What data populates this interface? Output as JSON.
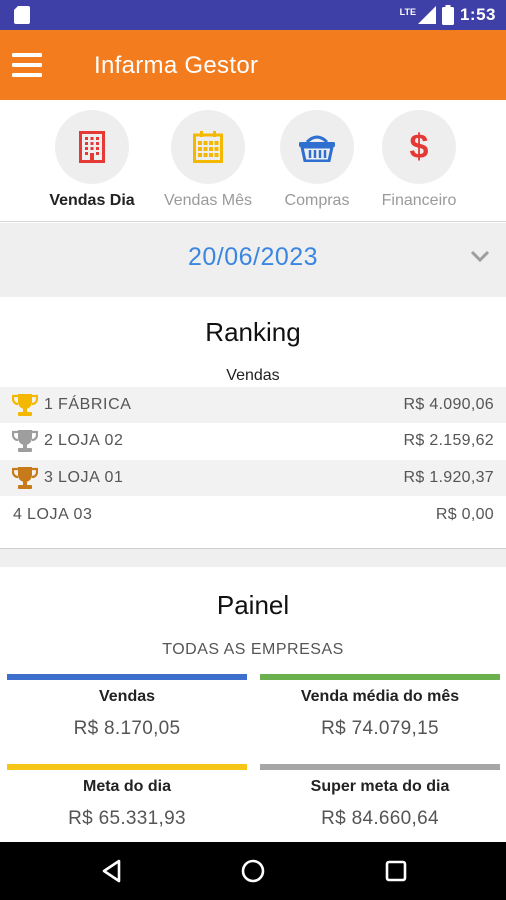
{
  "status_bar": {
    "network_label": "LTE",
    "battery_level": "1",
    "time": "1:53"
  },
  "app_bar": {
    "title": "Infarma Gestor",
    "menu_icon": "hamburger-menu-icon"
  },
  "tabs": [
    {
      "label": "Vendas Dia",
      "icon": "building-icon",
      "icon_color": "#e53935",
      "active": true
    },
    {
      "label": "Vendas Mês",
      "icon": "calendar-icon",
      "icon_color": "#f5b800",
      "active": false
    },
    {
      "label": "Compras",
      "icon": "basket-icon",
      "icon_color": "#2f6fd0",
      "active": false
    },
    {
      "label": "Financeiro",
      "icon": "dollar-icon",
      "icon_color": "#e53935",
      "active": false
    }
  ],
  "date_selector": {
    "date": "20/06/2023"
  },
  "ranking": {
    "title": "Ranking",
    "subtitle": "Vendas",
    "rows": [
      {
        "position": "1",
        "name": "FÁBRICA",
        "value": "R$ 4.090,06",
        "trophy": "gold",
        "trophy_color": "#f5b800"
      },
      {
        "position": "2",
        "name": "LOJA 02",
        "value": "R$ 2.159,62",
        "trophy": "silver",
        "trophy_color": "#9e9e9e"
      },
      {
        "position": "3",
        "name": "LOJA 01",
        "value": "R$ 1.920,37",
        "trophy": "bronze",
        "trophy_color": "#c77a1a"
      },
      {
        "position": "4",
        "name": "LOJA 03",
        "value": "R$ 0,00",
        "trophy": "",
        "trophy_color": ""
      }
    ]
  },
  "painel": {
    "title": "Painel",
    "subtitle": "TODAS AS EMPRESAS",
    "cards": [
      {
        "label": "Vendas",
        "value": "R$ 8.170,05",
        "color": "#3d6fcc"
      },
      {
        "label": "Venda média do mês",
        "value": "R$ 74.079,15",
        "color": "#6ab04c"
      },
      {
        "label": "Meta do dia",
        "value": "R$ 65.331,93",
        "color": "#f5c518"
      },
      {
        "label": "Super meta do dia",
        "value": "R$ 84.660,64",
        "color": "#a6a6a6"
      }
    ]
  },
  "nav_bar": {
    "buttons": [
      "back-icon",
      "home-icon",
      "recents-icon"
    ]
  }
}
